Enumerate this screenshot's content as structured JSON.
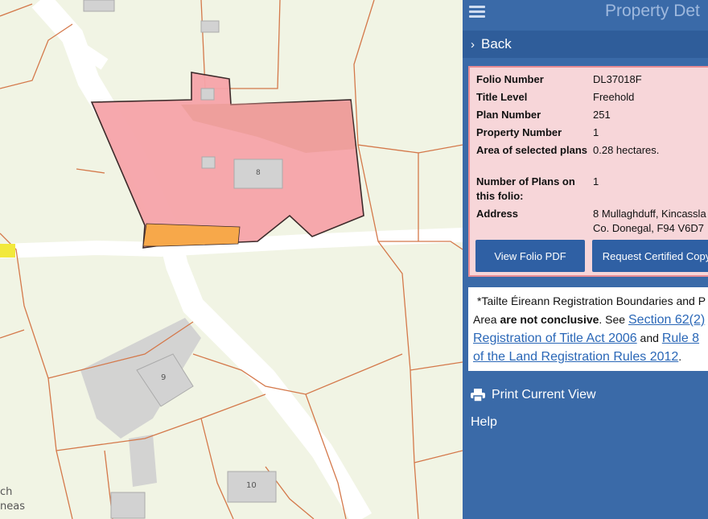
{
  "map": {
    "parcel_labels": [
      "8",
      "9",
      "10"
    ],
    "corner_text": [
      "ch",
      "neas"
    ],
    "colors": {
      "background": "#f1f4e4",
      "road": "#ffffff",
      "boundary": "#d4784a",
      "selected_fill": "#f6a3a9",
      "selected_outline": "#3c2a2a",
      "orange_strip": "#f7a84a",
      "yellow_marker": "#f2e93c",
      "building": "#c9c9c9"
    }
  },
  "panel": {
    "title": "Property Det",
    "back_label": "Back",
    "details": [
      {
        "key": "Folio Number",
        "value": "DL37018F"
      },
      {
        "key": "Title Level",
        "value": "Freehold"
      },
      {
        "key": "Plan Number",
        "value": "251"
      },
      {
        "key": "Property Number",
        "value": "1"
      },
      {
        "key": "Area of selected plans",
        "value": "0.28 hectares."
      },
      {
        "key": "Number of Plans on this folio:",
        "value": "1"
      },
      {
        "key": "Address",
        "value": "8 Mullaghduff, Kincassla Co. Donegal, F94 V6D7"
      }
    ],
    "buttons": {
      "view_pdf": "View Folio PDF",
      "certified_copy": "Request Certified Copy"
    },
    "notice": {
      "line1": "*Tailte Éireann Registration Boundaries and P",
      "line2_pre": "Area ",
      "line2_bold": "are not conclusive",
      "line2_post": ". See ",
      "link1": "Section 62(2)",
      "link2": "Registration of Title Act 2006",
      "and_text": " and ",
      "link3": "Rule 8",
      "link4": "of the Land Registration Rules 2012",
      "end": "."
    },
    "print_label": "Print Current View",
    "help_label": "Help"
  }
}
